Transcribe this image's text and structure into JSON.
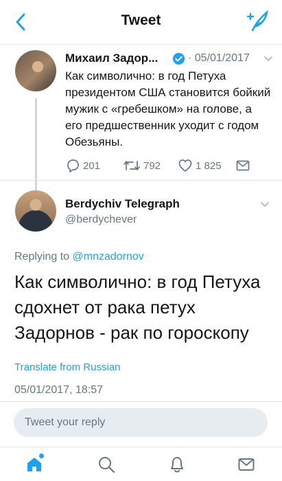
{
  "header": {
    "title": "Tweet"
  },
  "parent_tweet": {
    "author_name": "Михаил Задор...",
    "date": "· 05/01/2017",
    "text": "Как символично: в год Петуха президентом США становится бойкий мужик с «гребешком» на голове, а его предшественник уходит с годом Обезьяны.",
    "reply_count": "201",
    "retweet_count": "792",
    "like_count": "1 825"
  },
  "reply_tweet": {
    "author_name": "Berdychiv Telegraph",
    "handle": "@berdychever",
    "replying_prefix": "Replying to",
    "replying_mention": "@mnzadornov",
    "text": "Как символично: в год Петуха сдохнет от рака  петух Задорнов - рак по гороскопу",
    "translate_label": "Translate from Russian",
    "timestamp": "05/01/2017, 18:57"
  },
  "reply_input": {
    "placeholder": "Tweet your reply"
  },
  "colors": {
    "accent": "#1da1f2",
    "muted": "#657786",
    "text": "#14171a",
    "border": "#e1e8ed"
  },
  "icons": [
    "back-chevron-icon",
    "compose-feather-icon",
    "verified-badge-icon",
    "caret-down-icon",
    "reply-icon",
    "retweet-icon",
    "like-icon",
    "dm-icon",
    "home-icon",
    "search-icon",
    "notifications-icon",
    "messages-icon"
  ]
}
